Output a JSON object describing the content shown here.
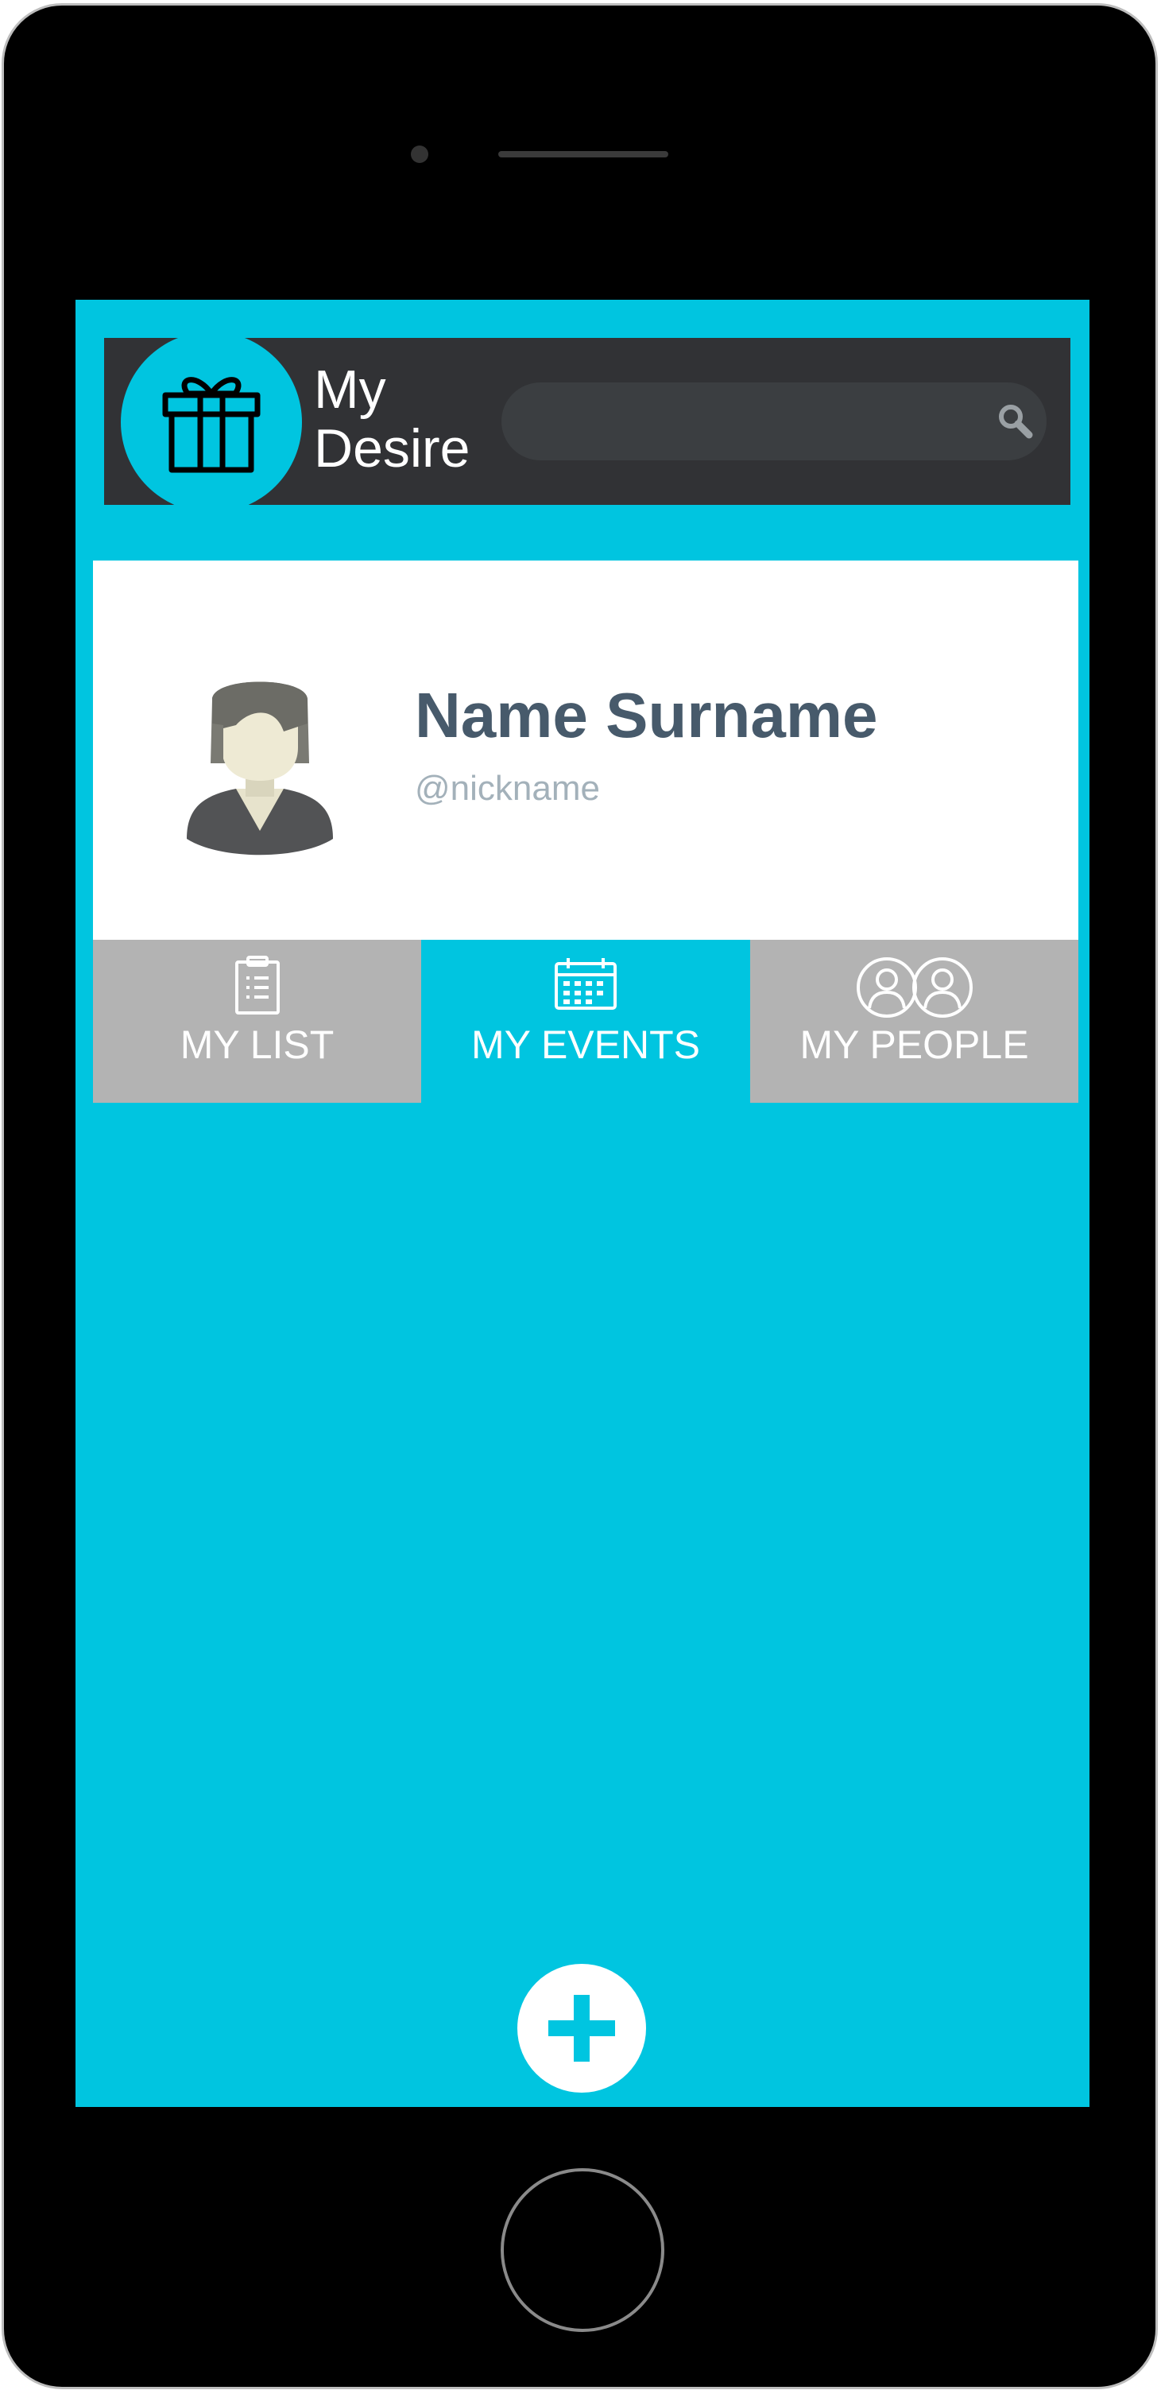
{
  "app": {
    "title_line1": "My",
    "title_line2": "Desire"
  },
  "search": {
    "value": "",
    "placeholder": ""
  },
  "profile": {
    "name": "Name Surname",
    "nickname": "@nickname"
  },
  "tabs": [
    {
      "label": "MY LIST",
      "icon": "clipboard-list-icon",
      "active": false
    },
    {
      "label": "MY EVENTS",
      "icon": "calendar-icon",
      "active": true
    },
    {
      "label": "MY PEOPLE",
      "icon": "people-icon",
      "active": false
    }
  ],
  "fab": {
    "icon": "plus-icon"
  },
  "colors": {
    "accent": "#00c5e0",
    "header": "#313235",
    "tab_inactive": "#b3b3b3",
    "name_text": "#475a6b",
    "nickname_text": "#a3b1ba"
  }
}
